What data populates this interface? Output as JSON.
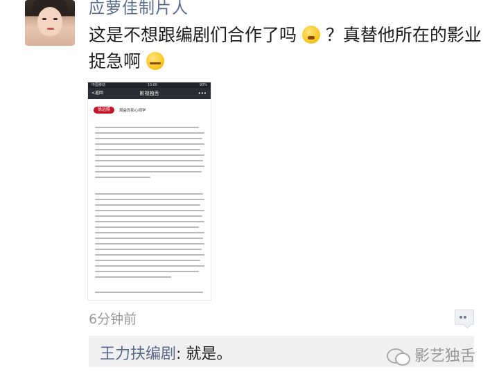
{
  "post": {
    "username": "应萝佳制片人",
    "text": "这是不想跟编剧们合作了吗",
    "text_tail": "？真替他所在的影业捉急啊",
    "emoji1": "thinking-emoji-icon",
    "emoji2": "sly-smile-emoji-icon",
    "timestamp": "6分钟前"
  },
  "embedded_screenshot": {
    "status_left": "中国移动",
    "status_time": "10:00",
    "status_right": "90%",
    "nav_back": "<返回",
    "nav_title": "影视独舌",
    "nav_more": "•••",
    "badge": "徐远照",
    "subhead": "周益尚影心视学"
  },
  "comment": {
    "author": "王力扶编剧",
    "separator": ": ",
    "text": "就是。"
  },
  "watermark": {
    "icon": "wechat-icon",
    "text": "影艺独舌"
  }
}
